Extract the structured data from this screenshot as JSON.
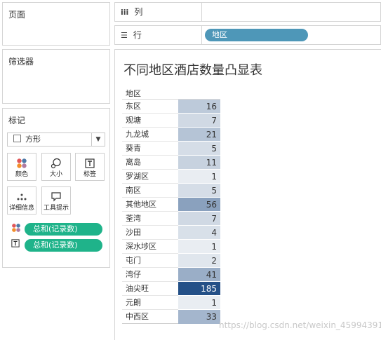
{
  "pages_panel": {
    "title": "页面"
  },
  "filters_panel": {
    "title": "筛选器"
  },
  "marks_panel": {
    "title": "标记",
    "mark_type": "方形",
    "buttons": {
      "color": "颜色",
      "size": "大小",
      "label": "标签",
      "detail": "详细信息",
      "tooltip": "工具提示"
    },
    "pills": [
      "总和(记录数)",
      "总和(记录数)"
    ]
  },
  "shelves": {
    "columns": {
      "icon": "iii",
      "label": "列"
    },
    "rows": {
      "icon": "☰",
      "label": "行",
      "field": "地区"
    }
  },
  "viz": {
    "title": "不同地区酒店数量凸显表",
    "column_header": "地区",
    "rows": [
      {
        "name": "东区",
        "value": "16"
      },
      {
        "name": "观塘",
        "value": "7"
      },
      {
        "name": "九龙城",
        "value": "21"
      },
      {
        "name": "葵青",
        "value": "5"
      },
      {
        "name": "离岛",
        "value": "11"
      },
      {
        "name": "罗湖区",
        "value": "1"
      },
      {
        "name": "南区",
        "value": "5"
      },
      {
        "name": "其他地区",
        "value": "56"
      },
      {
        "name": "荃湾",
        "value": "7"
      },
      {
        "name": "沙田",
        "value": "4"
      },
      {
        "name": "深水埗区",
        "value": "1"
      },
      {
        "name": "屯门",
        "value": "2"
      },
      {
        "name": "湾仔",
        "value": "41"
      },
      {
        "name": "油尖旺",
        "value": "185"
      },
      {
        "name": "元朗",
        "value": "1"
      },
      {
        "name": "中西区",
        "value": "33"
      }
    ]
  },
  "watermark": "https://blog.csdn.net/weixin_45994391"
}
